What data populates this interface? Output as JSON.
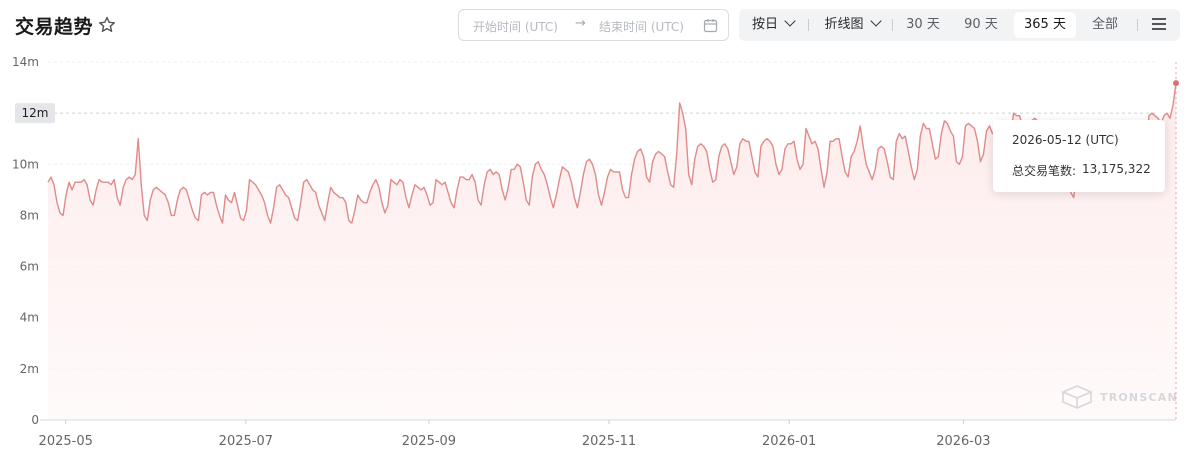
{
  "header": {
    "title": "交易趋势"
  },
  "date_range": {
    "start_placeholder": "开始时间 (UTC)",
    "arrow": "→",
    "end_placeholder": "结束时间 (UTC)"
  },
  "toolbar": {
    "granularity": "按日",
    "chart_type": "折线图",
    "ranges": [
      "30 天",
      "90 天",
      "365 天",
      "全部"
    ],
    "active_range": "365 天"
  },
  "tooltip": {
    "date": "2026-05-12 (UTC)",
    "label": "总交易笔数:",
    "value": "13,175,322"
  },
  "watermark": "TRONSCAN",
  "colors": {
    "line": "#e08a8a",
    "area_top": "#fdeeee",
    "dot": "#e07070",
    "grid": "#eceef1",
    "axis_text": "#666666"
  },
  "chart_data": {
    "type": "area",
    "title": "",
    "xlabel": "",
    "ylabel": "",
    "x_tick_labels": [
      "2025-05",
      "2025-07",
      "2025-09",
      "2025-11",
      "2026-01",
      "2026-03"
    ],
    "y_tick_labels": [
      "0",
      "2m",
      "4m",
      "6m",
      "8m",
      "10m",
      "12m",
      "14m"
    ],
    "ylim": [
      0,
      14000000
    ],
    "grid": "horizontal",
    "highlighted_y_label": "12m",
    "x_start": "2025-04-25",
    "x_end": "2026-05-12",
    "series": [
      {
        "values": [
          9300000,
          9500000,
          9200000,
          8500000,
          8100000,
          8000000,
          8800000,
          9300000,
          9000000,
          9300000,
          9300000,
          9300000,
          9400000,
          9200000,
          8600000,
          8400000,
          9000000,
          9400000,
          9300000,
          9300000,
          9300000,
          9200000,
          9400000,
          8700000,
          8400000,
          9100000,
          9400000,
          9500000,
          9400000,
          9600000,
          11000000,
          9200000,
          8000000,
          7800000,
          8600000,
          9000000,
          9100000,
          9000000,
          8900000,
          8800000,
          8500000,
          8000000,
          8000000,
          8600000,
          9000000,
          9100000,
          9000000,
          8600000,
          8200000,
          7900000,
          7800000,
          8800000,
          8900000,
          8800000,
          8900000,
          8900000,
          8400000,
          8000000,
          7700000,
          8800000,
          8600000,
          8500000,
          8900000,
          8400000,
          7900000,
          7800000,
          8200000,
          9400000,
          9300000,
          9200000,
          9000000,
          8800000,
          8500000,
          8000000,
          7700000,
          8300000,
          9100000,
          9200000,
          9000000,
          8800000,
          8700000,
          8300000,
          7900000,
          7800000,
          8500000,
          9300000,
          9400000,
          9200000,
          9000000,
          8900000,
          8400000,
          8100000,
          7800000,
          8500000,
          9100000,
          8900000,
          8800000,
          8700000,
          8700000,
          8500000,
          7800000,
          7700000,
          8200000,
          8800000,
          8600000,
          8500000,
          8500000,
          8900000,
          9200000,
          9400000,
          9100000,
          8500000,
          8100000,
          8400000,
          9400000,
          9300000,
          9200000,
          9400000,
          9300000,
          8700000,
          8300000,
          8800000,
          9200000,
          9100000,
          9000000,
          9100000,
          8800000,
          8400000,
          8500000,
          9400000,
          9300000,
          9200000,
          9300000,
          8900000,
          8500000,
          8300000,
          9000000,
          9500000,
          9500000,
          9400000,
          9400000,
          9600000,
          9300000,
          8600000,
          8400000,
          9200000,
          9700000,
          9800000,
          9600000,
          9700000,
          9600000,
          9000000,
          8600000,
          9100000,
          9800000,
          9800000,
          10000000,
          9900000,
          9300000,
          8600000,
          8400000,
          9500000,
          10000000,
          10100000,
          9800000,
          9600000,
          9200000,
          8700000,
          8300000,
          8800000,
          9400000,
          9900000,
          9800000,
          9700000,
          9300000,
          8700000,
          8300000,
          8900000,
          9600000,
          10100000,
          10200000,
          10000000,
          9600000,
          8800000,
          8400000,
          8900000,
          9500000,
          9800000,
          9700000,
          9700000,
          9700000,
          9000000,
          8700000,
          8700000,
          9600000,
          10200000,
          10500000,
          10600000,
          10300000,
          9500000,
          9300000,
          10100000,
          10400000,
          10500000,
          10400000,
          10300000,
          9700000,
          9200000,
          9100000,
          10400000,
          12400000,
          12000000,
          11400000,
          9600000,
          9200000,
          10200000,
          10700000,
          10800000,
          10700000,
          10500000,
          9800000,
          9300000,
          9400000,
          10300000,
          10700000,
          10800000,
          10600000,
          10100000,
          9600000,
          9900000,
          10800000,
          11000000,
          10900000,
          10900000,
          10300000,
          9700000,
          9500000,
          10700000,
          10900000,
          11000000,
          10900000,
          10700000,
          10000000,
          9600000,
          9800000,
          10600000,
          10800000,
          10800000,
          10900000,
          10200000,
          9800000,
          10000000,
          11400000,
          11100000,
          10800000,
          10900000,
          10600000,
          9800000,
          9100000,
          9700000,
          10900000,
          10900000,
          11000000,
          11000000,
          10300000,
          9700000,
          9500000,
          10300000,
          10500000,
          10900000,
          11500000,
          10700000,
          10000000,
          9700000,
          9400000,
          9800000,
          10600000,
          10700000,
          10600000,
          10100000,
          9500000,
          9400000,
          10900000,
          11200000,
          11000000,
          11100000,
          10500000,
          9900000,
          9400000,
          9800000,
          11100000,
          11600000,
          11400000,
          11400000,
          10800000,
          10200000,
          10300000,
          11200000,
          11700000,
          11600000,
          11300000,
          11100000,
          10100000,
          10000000,
          10300000,
          11500000,
          11600000,
          11500000,
          11400000,
          10900000,
          10100000,
          10400000,
          11300000,
          11500000,
          11200000,
          11300000,
          11100000,
          10200000,
          9900000,
          9700000,
          11100000,
          12000000,
          11900000,
          11900000,
          11500000,
          11100000,
          10600000,
          11700000,
          11800000,
          11700000,
          11500000,
          11000000,
          10100000,
          9800000,
          9900000,
          10700000,
          10800000,
          10800000,
          10600000,
          9900000,
          8900000,
          8700000,
          9700000,
          10600000,
          10700000,
          10600000,
          10700000,
          10600000,
          10300000,
          10000000,
          10400000,
          11200000,
          11400000,
          11200000,
          11300000,
          11100000,
          10400000,
          9800000,
          10000000,
          11100000,
          11400000,
          11200000,
          11100000,
          10600000,
          10500000,
          10400000,
          11900000,
          12000000,
          11900000,
          11800000,
          11600000,
          11900000,
          12000000,
          11800000,
          12300000,
          13175322
        ]
      }
    ]
  }
}
